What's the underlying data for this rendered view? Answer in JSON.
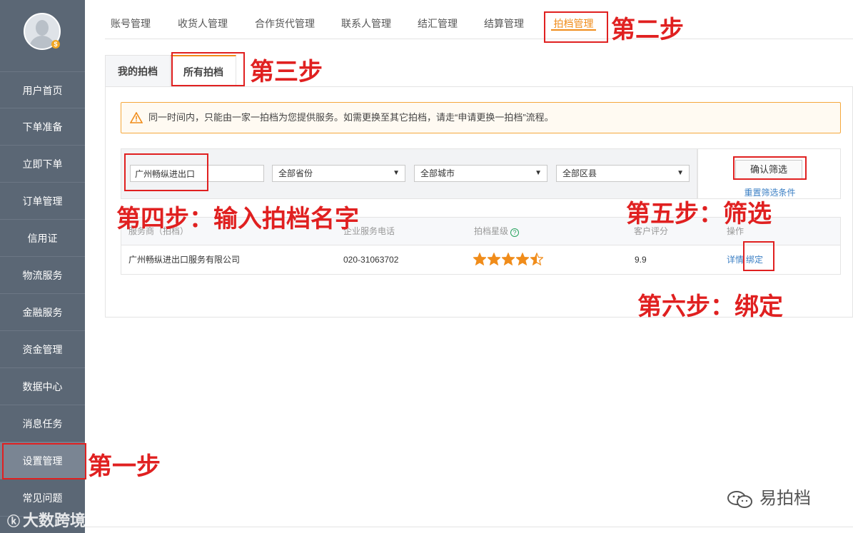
{
  "sidebar": {
    "items": [
      {
        "label": "用户首页"
      },
      {
        "label": "下单准备"
      },
      {
        "label": "立即下单"
      },
      {
        "label": "订单管理"
      },
      {
        "label": "信用证"
      },
      {
        "label": "物流服务"
      },
      {
        "label": "金融服务"
      },
      {
        "label": "资金管理"
      },
      {
        "label": "数据中心"
      },
      {
        "label": "消息任务"
      },
      {
        "label": "设置管理"
      },
      {
        "label": "常见问题"
      }
    ],
    "active": "设置管理"
  },
  "top_tabs": [
    {
      "label": "账号管理"
    },
    {
      "label": "收货人管理"
    },
    {
      "label": "合作货代管理"
    },
    {
      "label": "联系人管理"
    },
    {
      "label": "结汇管理"
    },
    {
      "label": "结算管理"
    },
    {
      "label": "拍档管理"
    }
  ],
  "top_tabs_active": "拍档管理",
  "sub_tabs": [
    {
      "label": "我的拍档"
    },
    {
      "label": "所有拍档"
    }
  ],
  "sub_tabs_active": "所有拍档",
  "notice": {
    "text": "同一时间内，只能由一家一拍档为您提供服务。如需更换至其它拍档，请走“申请更换一拍档”流程。",
    "icon": "warning-icon"
  },
  "filter": {
    "name_value": "广州畅纵进出口",
    "province": "全部省份",
    "city": "全部城市",
    "district": "全部区县",
    "confirm_label": "确认筛选",
    "reset_label": "重置筛选条件"
  },
  "table": {
    "headers": {
      "name": "服务商（拍档）",
      "phone": "企业服务电话",
      "rating": "拍档星级",
      "score": "客户评分",
      "action": "操作"
    },
    "rows": [
      {
        "name": "广州畅纵进出口服务有限公司",
        "phone": "020-31063702",
        "stars": 4.5,
        "score": "9.9",
        "detail": "详情",
        "bind": "绑定"
      }
    ]
  },
  "annotations": {
    "step1": "第一步",
    "step2": "第二步",
    "step3": "第三步",
    "step4": "第四步：输入拍档名字",
    "step5": "第五步：筛选",
    "step6": "第六步：绑定"
  },
  "watermarks": {
    "left": "大数跨境",
    "right": "易拍档"
  },
  "colors": {
    "sidebar": "#5b6775",
    "accent": "#f08c1a",
    "annotation": "#e02020",
    "link": "#3b7fc4",
    "star": "#f08c1a"
  }
}
